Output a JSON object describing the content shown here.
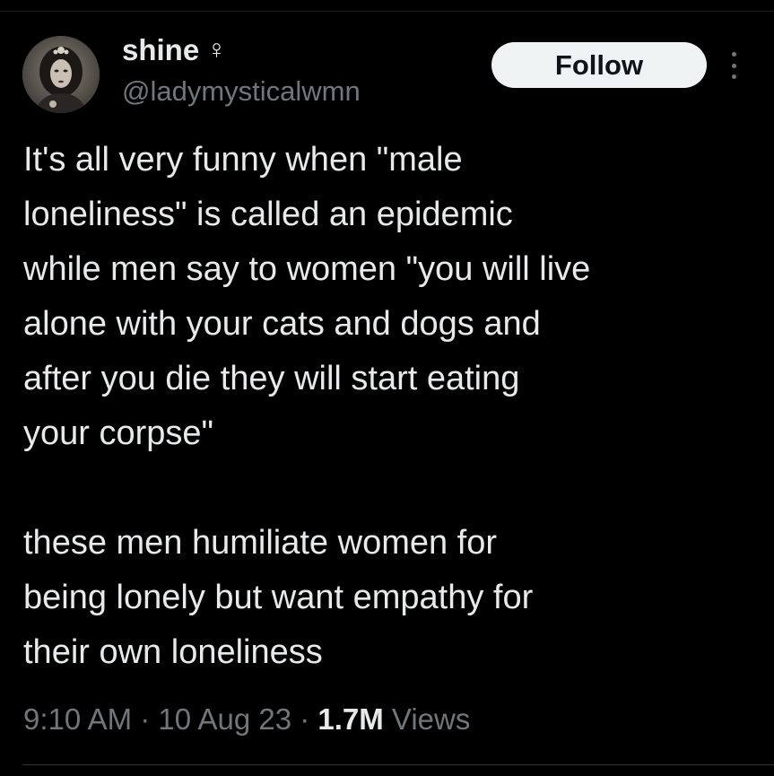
{
  "author": {
    "display_name": "shine",
    "gender_symbol": "♀",
    "handle": "@ladymysticalwmn"
  },
  "follow_label": "Follow",
  "more_icon": "more-dots-vertical-icon",
  "tweet": {
    "paragraph1_lines": [
      "It's all very funny when \"male",
      "loneliness\" is called an epidemic",
      "while men say to women \"you will live",
      "alone with your cats and dogs and",
      "after you die they will start eating",
      "your corpse\""
    ],
    "paragraph2_lines": [
      "these men humiliate women for",
      "being lonely but want empathy for",
      "their own loneliness"
    ]
  },
  "meta": {
    "time": "9:10 AM",
    "separator": " · ",
    "date": "10 Aug 23",
    "views_count": "1.7M",
    "views_label": " Views"
  },
  "colors": {
    "background": "#000000",
    "text_primary": "#e7e9ea",
    "text_secondary": "#71767b",
    "follow_bg": "#eff3f4",
    "follow_text": "#0f1419"
  }
}
